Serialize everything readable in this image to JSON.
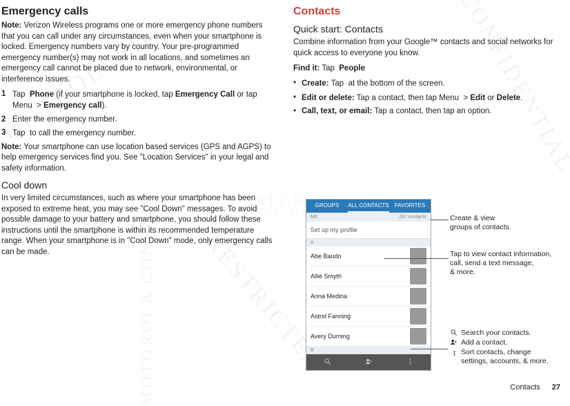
{
  "left": {
    "h_emergency": "Emergency calls",
    "note1_label": "Note:",
    "note1_body": " Verizon Wireless programs one or more emergency phone numbers that you can call under any circumstances, even when your smartphone is locked. Emergency numbers vary by country. Your pre-programmed emergency number(s) may not work in all locations, and sometimes an emergency call cannot be placed due to network, environmental, or interference issues.",
    "step1_num": "1",
    "step1_a": "Tap ",
    "step1_phone": " Phone",
    "step1_b": " (if your smartphone is locked, tap ",
    "step1_emcall": "Emergency Call",
    "step1_or": " or tap Menu ",
    "step1_arrow": " > ",
    "step1_emcall2": "Emergency call",
    "step1_end": ").",
    "step2_num": "2",
    "step2": "Enter the emergency number.",
    "step3_num": "3",
    "step3_a": "Tap ",
    "step3_b": " to call the emergency number.",
    "note2_label": "Note:",
    "note2_body": " Your smartphone can use location based services (GPS and AGPS) to help emergency services find you. See \"Location Services\" in your legal and safety information.",
    "h_cool": "Cool down",
    "cool_body": "In very limited circumstances, such as where your smartphone has been exposed to extreme heat, you may see \"Cool Down\" messages. To avoid possible damage to your battery and smartphone, you should follow these instructions until the smartphone is within its recommended temperature range. When your smartphone is in \"Cool Down\" mode, only emergency calls can be made."
  },
  "right": {
    "h_contacts": "Contacts",
    "h_quick": "Quick start: Contacts",
    "intro": "Combine information from your Google™ contacts and social networks for quick access to everyone you know.",
    "findit_label": "Find it:",
    "findit_tap": " Tap ",
    "findit_people": " People",
    "b1_label": "Create:",
    "b1_a": " Tap ",
    "b1_b": " at the bottom of the screen.",
    "b2_label": "Edit or delete:",
    "b2_a": " Tap a contact, then tap Menu ",
    "b2_arrow": " > ",
    "b2_edit": "Edit",
    "b2_or": " or ",
    "b2_delete": "Delete",
    "b2_end": ".",
    "b3_label": "Call, text, or email:",
    "b3_body": " Tap a contact, then tap an option."
  },
  "phone": {
    "tab_groups": "GROUPS",
    "tab_all": "ALL CONTACTS",
    "tab_fav": "FAVORITES",
    "me": "ME",
    "count": "297 contacts",
    "setup": "Set up my profile",
    "sec_a": "A",
    "c1": "Abe Baudo",
    "c2": "Allie Smyth",
    "c3": "Anna Medina",
    "c4": "Astrid Fanning",
    "c5": "Avery Durning",
    "sec_b": "B"
  },
  "callouts": {
    "groups": "Create & view\ngroups of contacts.",
    "tapview": "Tap to view contact information,\ncall, send a text message,\n& more.",
    "search": "Search your contacts.",
    "add": "Add a contact.",
    "sort": "Sort contacts, change\nsettings, accounts, & more."
  },
  "footer": {
    "section": "Contacts",
    "page": "27"
  },
  "watermark": {
    "date": "2013.06.27",
    "fcc": "FCC DRAFT"
  }
}
